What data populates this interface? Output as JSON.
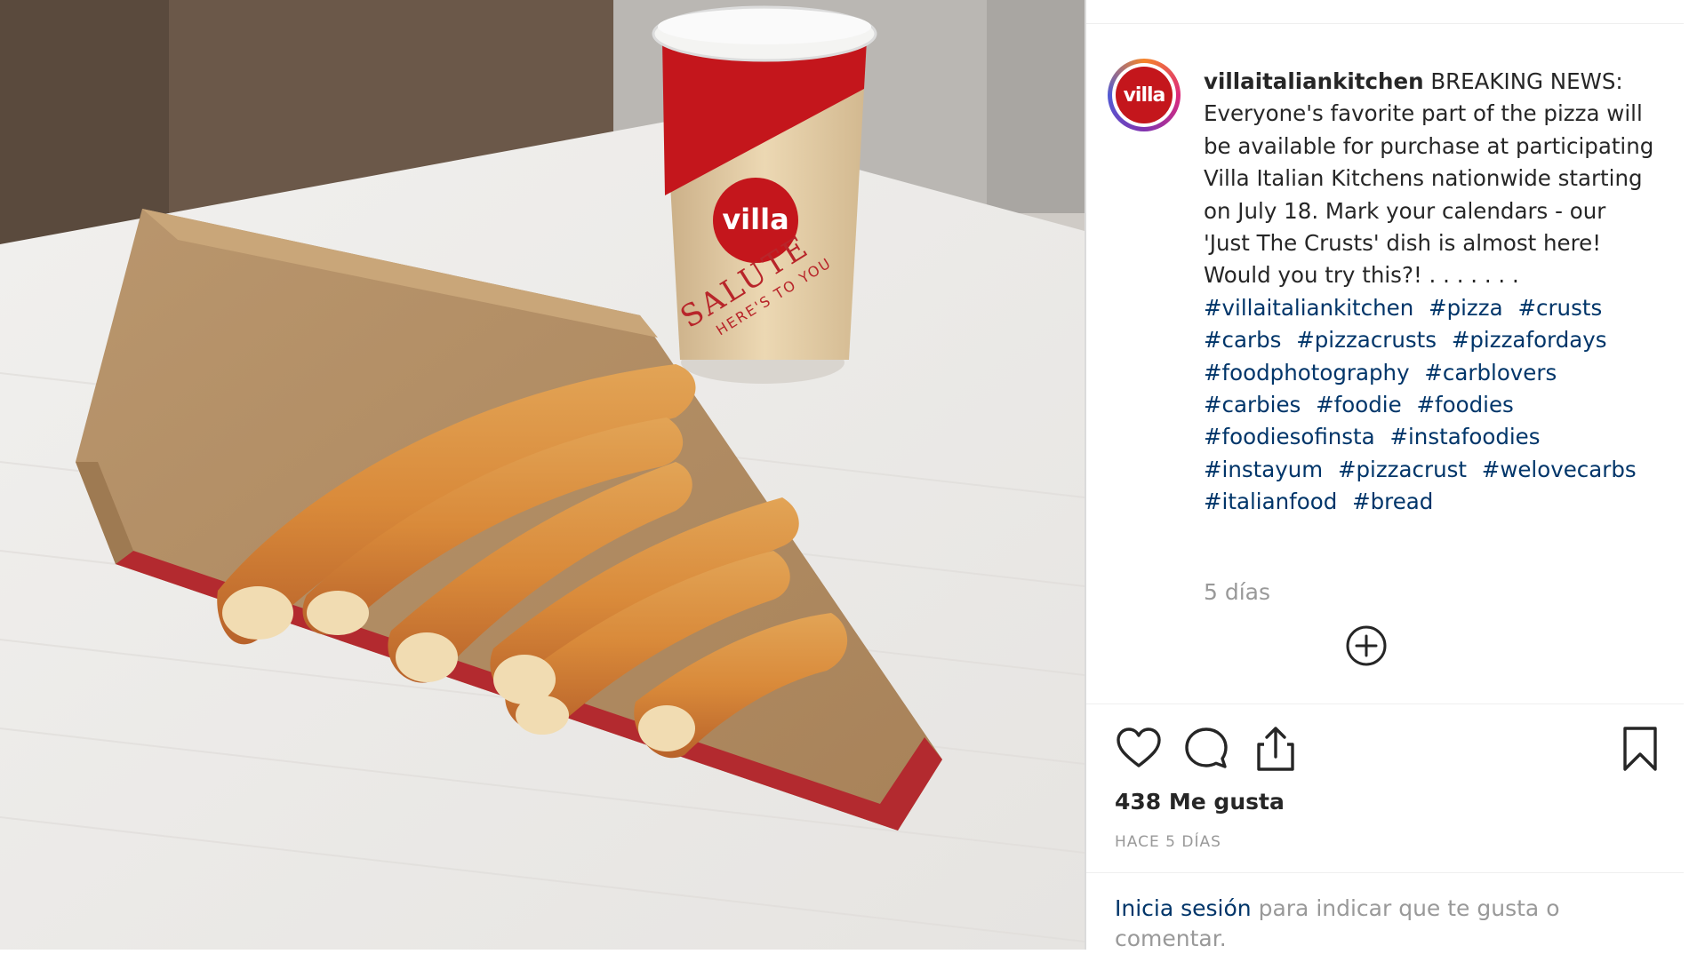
{
  "post": {
    "username": "villaitaliankitchen",
    "avatar_text": "villa",
    "caption_lines": [
      "BREAKING NEWS:",
      "Everyone's favorite part of the pizza",
      "will be available for purchase at",
      "participating Villa Italian Kitchens",
      "nationwide starting on July 18. Mark",
      "your calendars - our 'Just The Crusts'",
      "dish is almost here! Would you try",
      "this?! . . . . . . ."
    ],
    "hashtags": [
      "#villaitaliankitchen",
      "#pizza",
      "#crusts",
      "#carbs",
      "#pizzacrusts",
      "#pizzafordays",
      "#foodphotography",
      "#carblovers",
      "#carbies",
      "#foodie",
      "#foodies",
      "#foodiesofinsta",
      "#instafoodies",
      "#instayum",
      "#pizzacrust",
      "#welovecarbs",
      "#italianfood",
      "#bread"
    ],
    "caption_time": "5 días",
    "likes": "438 Me gusta",
    "posted_ago": "HACE 5 DÍAS",
    "login_link": "Inicia sesión",
    "login_text": " para indicar que te gusta o comentar."
  },
  "photo": {
    "cup_brand": "villa",
    "cup_text_1": "SALUTE",
    "cup_text_2": "HERE'S TO YOU"
  },
  "icons": {
    "like": "heart-icon",
    "comment": "comment-icon",
    "share": "share-icon",
    "save": "bookmark-icon",
    "more": "plus-circle-icon"
  },
  "colors": {
    "brand_red": "#c4161c",
    "link_blue": "#003569",
    "muted_gray": "#999999"
  }
}
